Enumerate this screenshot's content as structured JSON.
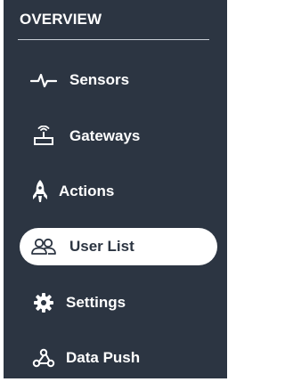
{
  "sidebar": {
    "header": "OVERVIEW",
    "items": [
      {
        "label": "Sensors",
        "icon": "pulse-icon",
        "active": false
      },
      {
        "label": "Gateways",
        "icon": "router-icon",
        "active": false
      },
      {
        "label": "Actions",
        "icon": "rocket-icon",
        "active": false
      },
      {
        "label": "User List",
        "icon": "users-icon",
        "active": true
      },
      {
        "label": "Settings",
        "icon": "gear-icon",
        "active": false
      },
      {
        "label": "Data Push",
        "icon": "webhook-icon",
        "active": false
      }
    ]
  },
  "colors": {
    "background": "#2c3542",
    "text": "#ffffff",
    "active_bg": "#ffffff",
    "active_text": "#2c3542"
  }
}
